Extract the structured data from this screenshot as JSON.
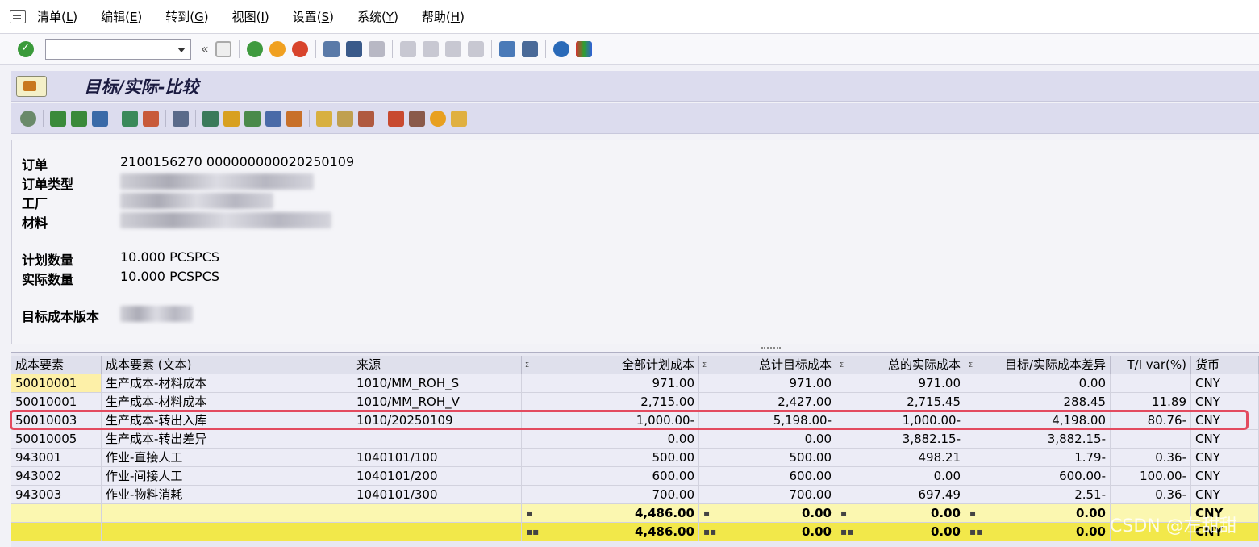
{
  "menu": [
    {
      "text": "清单(",
      "key": "L",
      "end": ")"
    },
    {
      "text": "编辑(",
      "key": "E",
      "end": ")"
    },
    {
      "text": "转到(",
      "key": "G",
      "end": ")"
    },
    {
      "text": "视图(",
      "key": "I",
      "end": ")"
    },
    {
      "text": "设置(",
      "key": "S",
      "end": ")"
    },
    {
      "text": "系统(",
      "key": "Y",
      "end": ")"
    },
    {
      "text": "帮助(",
      "key": "H",
      "end": ")"
    }
  ],
  "title": "目标/实际-比较",
  "header": {
    "order_label": "订单",
    "order_value": "2100156270 000000000020250109",
    "order_type_label": "订单类型",
    "plant_label": "工厂",
    "material_label": "材料",
    "planned_qty_label": "计划数量",
    "planned_qty_value": "10.000 PCSPCS",
    "actual_qty_label": "实际数量",
    "actual_qty_value": "10.000 PCSPCS",
    "target_version_label": "目标成本版本"
  },
  "table": {
    "columns": [
      "成本要素",
      "成本要素 (文本)",
      "来源",
      "全部计划成本",
      "总计目标成本",
      "总的实际成本",
      "目标/实际成本差异",
      "T/I var(%)",
      "货币"
    ],
    "rows": [
      [
        "50010001",
        "生产成本-材料成本",
        "1010/MM_ROH_S",
        "971.00",
        "971.00",
        "971.00",
        "0.00",
        "",
        "CNY"
      ],
      [
        "50010001",
        "生产成本-材料成本",
        "1010/MM_ROH_V",
        "2,715.00",
        "2,427.00",
        "2,715.45",
        "288.45",
        "11.89",
        "CNY"
      ],
      [
        "50010003",
        "生产成本-转出入库",
        "1010/20250109",
        "1,000.00-",
        "5,198.00-",
        "1,000.00-",
        "4,198.00",
        "80.76-",
        "CNY"
      ],
      [
        "50010005",
        "生产成本-转出差异",
        "",
        "0.00",
        "0.00",
        "3,882.15-",
        "3,882.15-",
        "",
        "CNY"
      ],
      [
        "943001",
        "作业-直接人工",
        "1040101/100",
        "500.00",
        "500.00",
        "498.21",
        "1.79-",
        "0.36-",
        "CNY"
      ],
      [
        "943002",
        "作业-间接人工",
        "1040101/200",
        "600.00",
        "600.00",
        "0.00",
        "600.00-",
        "100.00-",
        "CNY"
      ],
      [
        "943003",
        "作业-物料消耗",
        "1040101/300",
        "700.00",
        "700.00",
        "697.49",
        "2.51-",
        "0.36-",
        "CNY"
      ]
    ],
    "subtotal": [
      "4,486.00",
      "0.00",
      "0.00",
      "0.00",
      "CNY"
    ],
    "total": [
      "4,486.00",
      "0.00",
      "0.00",
      "0.00",
      "CNY"
    ],
    "subtotal_marker": "▪",
    "total_marker": "▪▪"
  },
  "watermark": "CSDN @左甜甜",
  "colors": {
    "highlight": "#e34a5f",
    "total": "#f2e84a",
    "subtotal": "#fbf7b0"
  }
}
